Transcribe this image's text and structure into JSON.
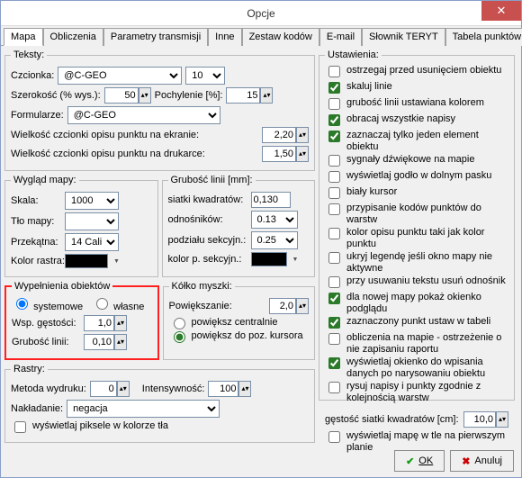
{
  "window": {
    "title": "Opcje"
  },
  "tabs": [
    "Mapa",
    "Obliczenia",
    "Parametry transmisji",
    "Inne",
    "Zestaw kodów",
    "E-mail",
    "Słownik TERYT",
    "Tabela punktów"
  ],
  "activeTab": 0,
  "teksty": {
    "legend": "Teksty:",
    "czcionka_lbl": "Czcionka:",
    "czcionka_val": "@C-GEO",
    "czcionka_size": "10",
    "szer_lbl": "Szerokość (% wys.):",
    "szer_val": "50",
    "poch_lbl": "Pochylenie [%]:",
    "poch_val": "15",
    "form_lbl": "Formularze:",
    "form_val": "@C-GEO",
    "wcoe_lbl": "Wielkość czcionki opisu punktu na ekranie:",
    "wcoe_val": "2,20",
    "wcod_lbl": "Wielkość czcionki opisu punktu na drukarce:",
    "wcod_val": "1,50"
  },
  "wyglad": {
    "legend": "Wygląd mapy:",
    "skala_lbl": "Skala:",
    "skala_val": "1000",
    "tlo_lbl": "Tło mapy:",
    "przek_lbl": "Przekątna:",
    "przek_val": "14 Cali",
    "kolor_lbl": "Kolor rastra:"
  },
  "grubosc": {
    "legend": "Grubość linii [mm]:",
    "siatki_lbl": "siatki kwadratów:",
    "siatki_val": "0,130",
    "odn_lbl": "odnośników:",
    "odn_val": "0.13",
    "podz_lbl": "podziału sekcyjn.:",
    "podz_val": "0.25",
    "kolor_lbl": "kolor p. sekcyjn.:"
  },
  "wyp": {
    "legend": "Wypełnienia obiektów",
    "sys": "systemowe",
    "wl": "własne",
    "wsp_lbl": "Wsp. gęstości:",
    "wsp_val": "1,0",
    "grub_lbl": "Grubość linii:",
    "grub_val": "0,10"
  },
  "kolko": {
    "legend": "Kółko myszki:",
    "pow_lbl": "Powiększanie:",
    "pow_val": "2,0",
    "c1": "powiększ centralnie",
    "c2": "powiększ do poz. kursora"
  },
  "rastry": {
    "legend": "Rastry:",
    "met_lbl": "Metoda wydruku:",
    "met_val": "0",
    "int_lbl": "Intensywność:",
    "int_val": "100",
    "nak_lbl": "Nakładanie:",
    "nak_val": "negacja",
    "pix_lbl": "wyświetlaj piksele w kolorze tła"
  },
  "ust": {
    "legend": "Ustawienia:",
    "items": [
      {
        "c": false,
        "t": "ostrzegaj przed usunięciem obiektu"
      },
      {
        "c": true,
        "t": "skaluj linie"
      },
      {
        "c": false,
        "t": "grubość linii ustawiana kolorem"
      },
      {
        "c": true,
        "t": "obracaj wszystkie napisy"
      },
      {
        "c": true,
        "t": "zaznaczaj tylko jeden element obiektu"
      },
      {
        "c": false,
        "t": "sygnały dźwiękowe na mapie"
      },
      {
        "c": false,
        "t": "wyświetlaj godło w dolnym pasku"
      },
      {
        "c": false,
        "t": "biały kursor"
      },
      {
        "c": false,
        "t": "przypisanie kodów punktów do warstw"
      },
      {
        "c": false,
        "t": "kolor opisu punktu taki jak kolor punktu"
      },
      {
        "c": false,
        "t": "ukryj legendę jeśli okno mapy nie aktywne"
      },
      {
        "c": false,
        "t": "przy usuwaniu tekstu usuń odnośnik"
      },
      {
        "c": true,
        "t": "dla nowej mapy pokaż okienko podglądu"
      },
      {
        "c": true,
        "t": "zaznaczony punkt ustaw w tabeli"
      },
      {
        "c": false,
        "t": "obliczenia na mapie - ostrzeżenie o nie zapisaniu raportu"
      },
      {
        "c": true,
        "t": "wyświetlaj okienko do wpisania danych po narysowaniu obiektu"
      },
      {
        "c": false,
        "t": "rysuj napisy i punkty zgodnie z kolejnością warstw"
      }
    ],
    "gest_lbl": "gęstość siatki kwadratów [cm]:",
    "gest_val": "10,0",
    "map_lbl": "wyświetlaj mapę w tle na pierwszym planie"
  },
  "buttons": {
    "ok": "OK",
    "cancel": "Anuluj"
  }
}
